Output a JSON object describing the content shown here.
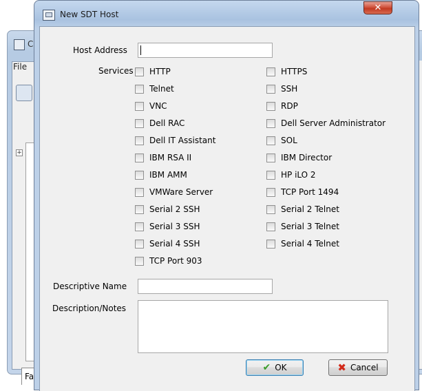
{
  "background_window": {
    "title_partial": "C",
    "menu_partial": "File",
    "tab_partial": "Faile",
    "close_glyph": "✕"
  },
  "dialog": {
    "title": "New SDT Host",
    "close_glyph": "✕"
  },
  "form": {
    "host_address_label": "Host Address",
    "host_address_value": "",
    "services_label": "Services",
    "services_left": [
      "HTTP",
      "Telnet",
      "VNC",
      "Dell RAC",
      "Dell IT Assistant",
      "IBM RSA II",
      "IBM AMM",
      "VMWare Server",
      "Serial 2 SSH",
      "Serial 3 SSH",
      "Serial 4 SSH",
      "TCP Port 903"
    ],
    "services_right": [
      "HTTPS",
      "SSH",
      "RDP",
      "Dell Server Administrator",
      "SOL",
      "IBM Director",
      "HP iLO 2",
      "TCP Port 1494",
      "Serial 2 Telnet",
      "Serial 3 Telnet",
      "Serial 4 Telnet"
    ],
    "descriptive_name_label": "Descriptive Name",
    "descriptive_name_value": "",
    "notes_label": "Description/Notes",
    "notes_value": ""
  },
  "buttons": {
    "ok_label": "OK",
    "cancel_label": "Cancel"
  },
  "icons": {
    "ok": "check-icon",
    "cancel": "x-icon",
    "title": "window-icon"
  },
  "colors": {
    "title_bar": "#bcd0e8",
    "close_button": "#c23a22",
    "client_bg": "#f0f0f0",
    "ok_check": "#3a9d2a",
    "cancel_x": "#d22a1a"
  }
}
